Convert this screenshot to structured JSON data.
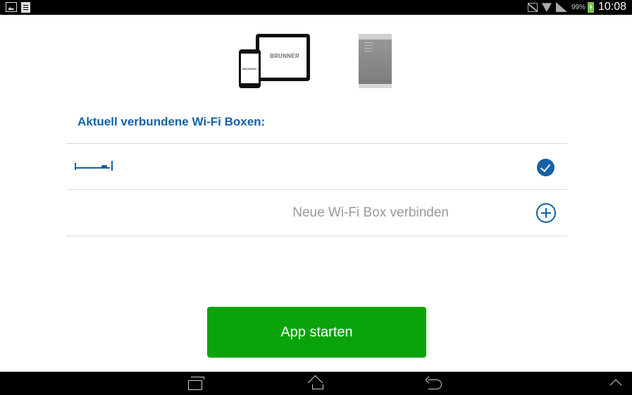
{
  "status_bar": {
    "battery_percent": "99%",
    "time": "10:08",
    "left_icons": [
      "gallery-icon",
      "document-icon"
    ],
    "right_icons": [
      "no-sim-icon",
      "wifi-icon",
      "signal-icon",
      "battery-charging-icon"
    ]
  },
  "illustration": {
    "brand_label": "BRUNNER"
  },
  "main": {
    "heading": "Aktuell verbundene Wi-Fi Boxen:",
    "connected_boxes": [
      {
        "icon": "bed-icon",
        "status_icon": "check-circle-icon"
      }
    ],
    "add_box_label": "Neue Wi-Fi Box verbinden",
    "add_box_icon": "plus-circle-icon",
    "start_button_label": "App starten"
  },
  "nav_bar": {
    "buttons": [
      "recent-apps-icon",
      "home-icon",
      "back-icon",
      "expand-up-icon"
    ]
  },
  "colors": {
    "accent": "#1561a6",
    "button_green": "#0aa40a",
    "muted_text": "#9a9a9a"
  }
}
